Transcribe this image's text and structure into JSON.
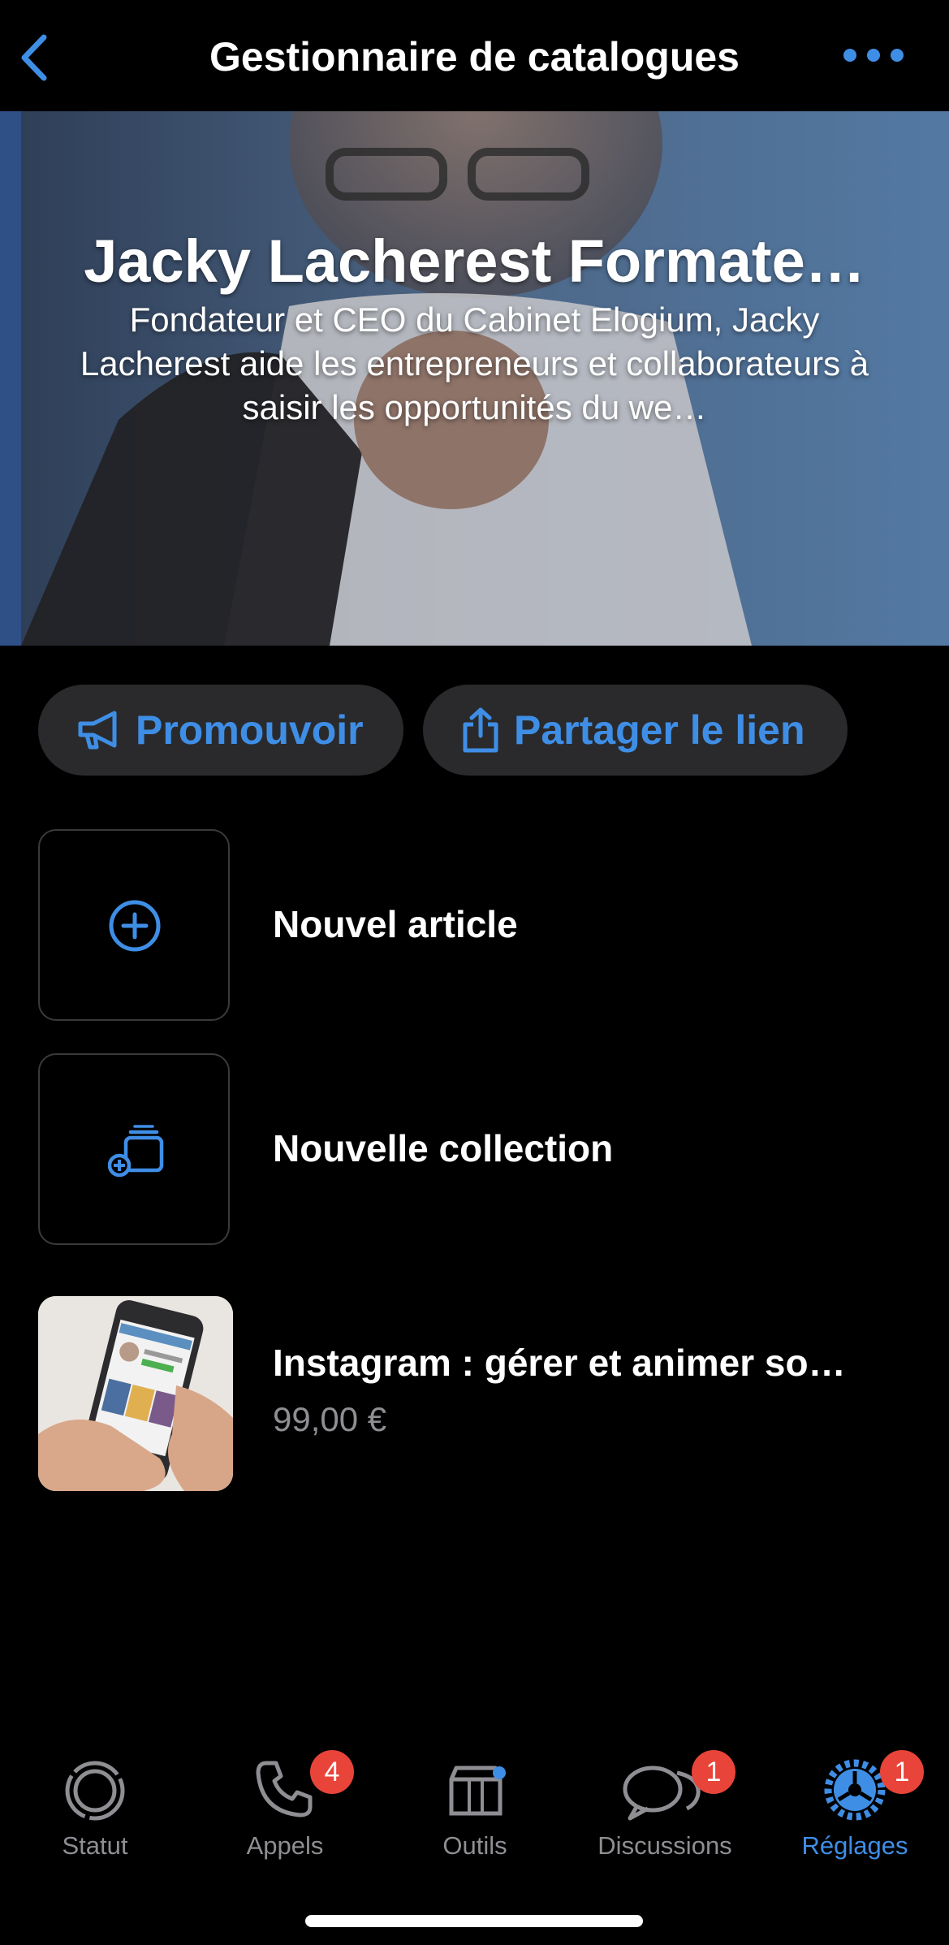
{
  "header": {
    "title": "Gestionnaire de catalogues",
    "back_icon": "chevron-left-icon",
    "more_icon": "ellipsis-icon"
  },
  "cover": {
    "title": "Jacky Lacherest Formate…",
    "description": "Fondateur et CEO du Cabinet Elogium, Jacky Lacherest aide les entrepreneurs et collaborateurs à saisir les opportunités du we…"
  },
  "actions": {
    "promote_label": "Promouvoir",
    "share_label": "Partager le lien"
  },
  "list": {
    "new_item_label": "Nouvel article",
    "new_collection_label": "Nouvelle collection",
    "product": {
      "title": "Instagram : gérer et animer so…",
      "price": "99,00 €"
    }
  },
  "tabs": [
    {
      "label": "Statut",
      "badge": ""
    },
    {
      "label": "Appels",
      "badge": "4"
    },
    {
      "label": "Outils",
      "badge": ""
    },
    {
      "label": "Discussions",
      "badge": "1"
    },
    {
      "label": "Réglages",
      "badge": "1"
    }
  ],
  "colors": {
    "accent": "#3f8ee6",
    "badge": "#e8443a",
    "background": "#000000",
    "pill": "#2a2a2c",
    "inactive": "#8e8e93"
  }
}
